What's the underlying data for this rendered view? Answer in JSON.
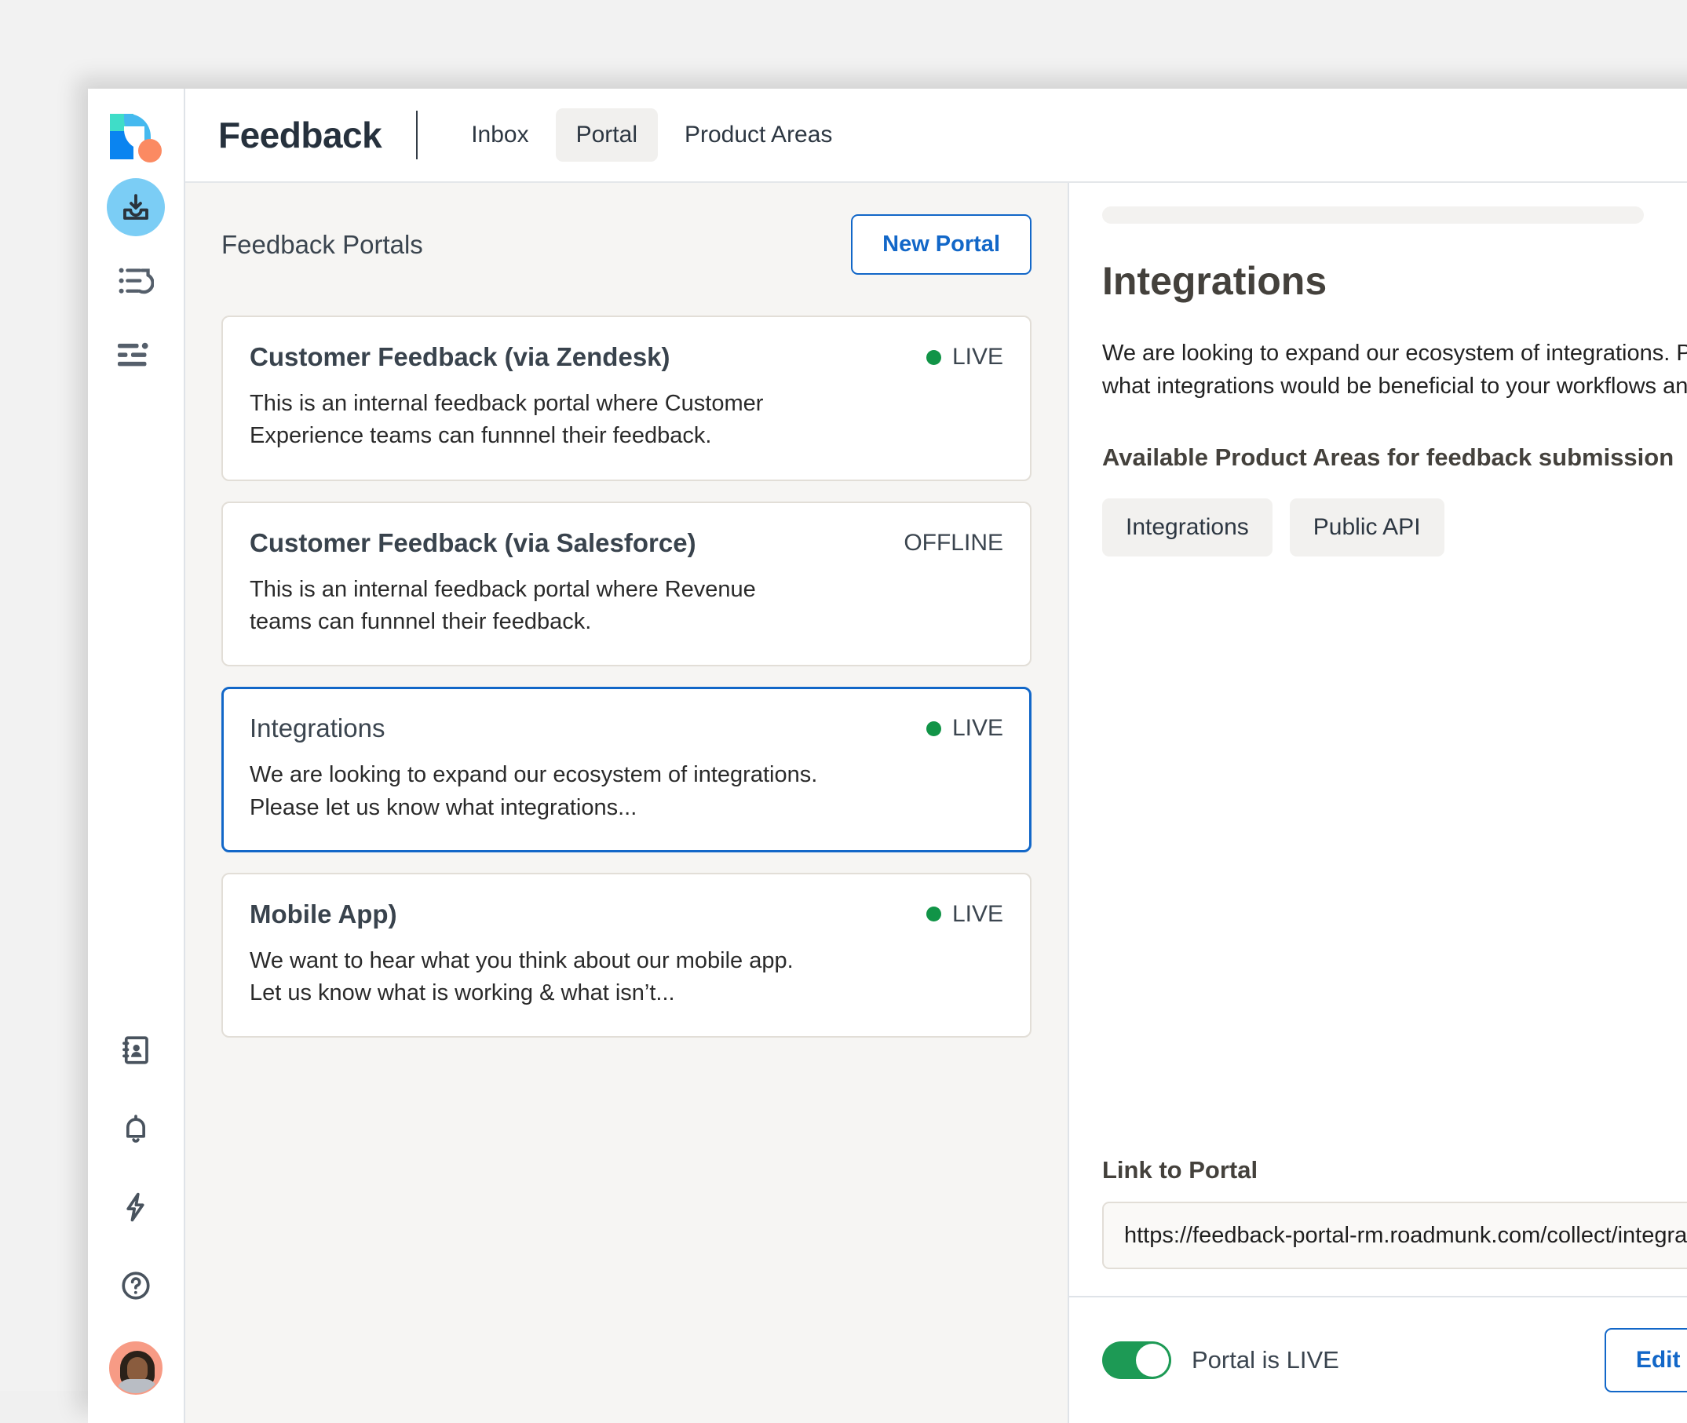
{
  "app": {
    "logo_name": "roadmunk-logo"
  },
  "header": {
    "title": "Feedback",
    "tabs": [
      {
        "label": "Inbox",
        "active": false,
        "name": "tab-inbox"
      },
      {
        "label": "Portal",
        "active": true,
        "name": "tab-portal"
      },
      {
        "label": "Product Areas",
        "active": false,
        "name": "tab-product-areas"
      }
    ]
  },
  "rail": {
    "items": [
      {
        "icon": "inbox-download-icon",
        "active": true
      },
      {
        "icon": "roadmap-list-icon",
        "active": false
      },
      {
        "icon": "text-lines-icon",
        "active": false
      }
    ],
    "bottom_items": [
      {
        "icon": "address-book-icon"
      },
      {
        "icon": "bell-icon"
      },
      {
        "icon": "lightning-bolt-icon"
      },
      {
        "icon": "help-circle-icon"
      }
    ],
    "avatar_name": "user-avatar"
  },
  "portals_pane": {
    "title": "Feedback Portals",
    "new_portal_label": "New Portal",
    "cards": [
      {
        "name": "Customer Feedback (via Zendesk)",
        "status": "LIVE",
        "live": true,
        "description": "This is an internal feedback portal where Customer Experience teams can funnnel their feedback.",
        "selected": false
      },
      {
        "name": "Customer Feedback (via Salesforce)",
        "status": "OFFLINE",
        "live": false,
        "description": "This is an internal feedback portal where Revenue teams can funnnel their feedback.",
        "selected": false
      },
      {
        "name": "Integrations",
        "status": "LIVE",
        "live": true,
        "description": "We are looking to expand our ecosystem of integrations. Please let us know what integrations...",
        "selected": true
      },
      {
        "name": "Mobile App)",
        "status": "LIVE",
        "live": true,
        "description": "We want to hear what you think about our mobile app. Let us know what is working & what isn’t...",
        "selected": false
      }
    ]
  },
  "detail": {
    "title": "Integrations",
    "description": "We are looking to expand our ecosystem of integrations. Please let us know what integrations would be beneficial to your workflows and systems.",
    "areas_label": "Available Product Areas for feedback submission",
    "areas": [
      {
        "label": "Integrations"
      },
      {
        "label": "Public API"
      }
    ],
    "link_label": "Link to Portal",
    "link_value": "https://feedback-portal-rm.roadmunk.com/collect/integrations",
    "toggle_label": "Portal is LIVE",
    "edit_label": "Edit Portal"
  },
  "colors": {
    "accent_blue": "#1267c8",
    "status_green": "#119447",
    "toggle_green": "#1d9a55",
    "rail_active": "#7bcdf5",
    "logo_blue": "#0a84f0",
    "logo_teal": "#3fddc8",
    "logo_orange": "#fb8a62"
  }
}
